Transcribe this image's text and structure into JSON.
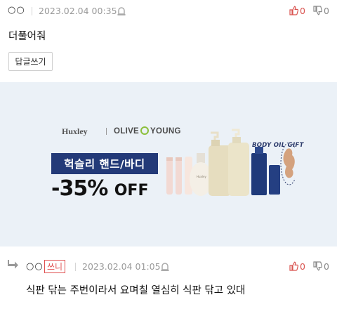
{
  "comment": {
    "nickname": "○○",
    "date": "2023.02.04 00:35",
    "body": "더풀어줘",
    "upvotes": "0",
    "downvotes": "0",
    "reply_button": "답글쓰기"
  },
  "ad": {
    "brand": "Huxley",
    "partner": "OLIVE YOUNG",
    "partner_left": "OLIVE",
    "partner_right": "YOUNG",
    "headline": "헉슬리 핸드/바디",
    "discount_num": "-35%",
    "discount_word": "OFF",
    "gift_label": "BODY OIL GIFT",
    "product_label": "Huxley",
    "accent_color": "#233a78"
  },
  "reply": {
    "nickname": "○○",
    "writer_badge": "쓰니",
    "date": "2023.02.04 01:05",
    "body": "식판 닦는 주번이라서 요며칠 열심히 식판 닦고 있대",
    "upvotes": "0",
    "downvotes": "0"
  },
  "icons": {
    "reply": "reply-arrow-icon",
    "report": "siren-icon",
    "up": "thumbs-up-icon",
    "down": "thumbs-down-icon"
  }
}
